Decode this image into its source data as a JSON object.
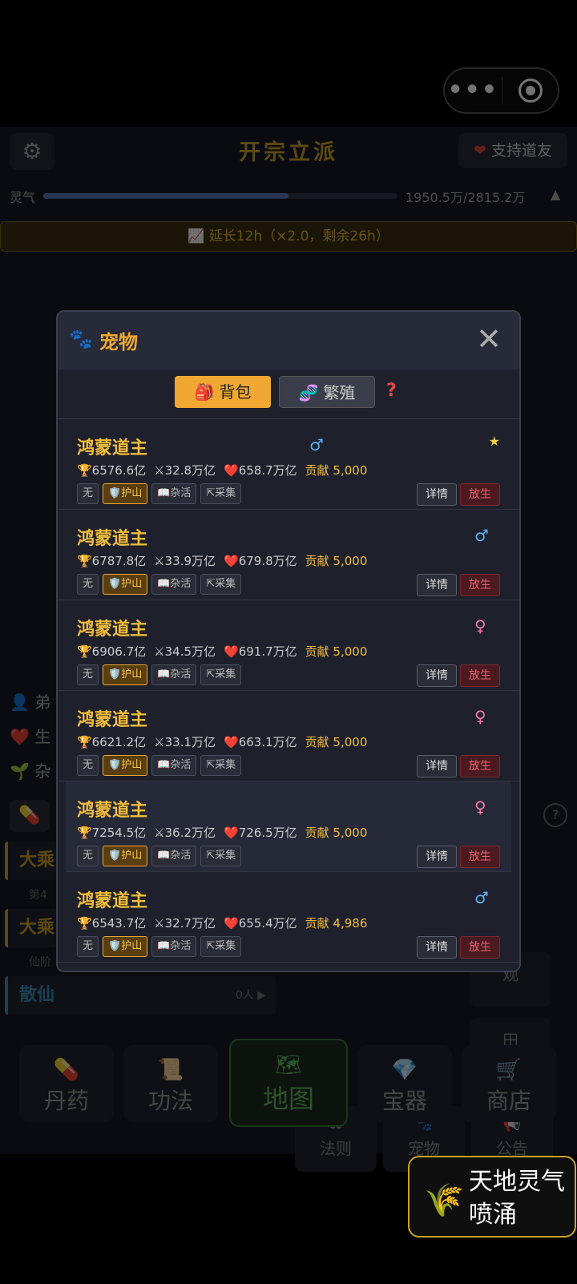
{
  "capsule": {
    "menu_icon": "more-dots-icon",
    "record_icon": "target-icon"
  },
  "header": {
    "title": "开宗立派",
    "support_label": "支持道友"
  },
  "qi": {
    "label": "灵气",
    "value_text": "1950.5万/2815.2万",
    "progress": 0.693
  },
  "boost_text": "📈 延长12h（×2.0，剩余26h）",
  "side_tags": [
    "👤 弟",
    "❤️ 生",
    "🌱 杂"
  ],
  "realms": [
    {
      "name": "大乘"
    },
    {
      "divider": "第4"
    },
    {
      "name": "大乘"
    },
    {
      "divider": "仙阶"
    },
    {
      "name": "散仙",
      "count": "0人 ▶"
    }
  ],
  "tiles": [
    {
      "label": "观",
      "icon": ""
    },
    {
      "label": "田",
      "icon": ""
    },
    {
      "label": "法则",
      "icon": "⚖"
    },
    {
      "label": "宠物",
      "icon": "🐾"
    },
    {
      "label": "公告",
      "icon": "📢"
    }
  ],
  "bottom_nav": [
    {
      "label": "丹药",
      "icon": "💊"
    },
    {
      "label": "功法",
      "icon": "📜"
    },
    {
      "label": "地图",
      "icon": "🗺"
    },
    {
      "label": "宝器",
      "icon": "💎"
    },
    {
      "label": "商店",
      "icon": "🛒"
    }
  ],
  "fab": {
    "text": "天地灵气喷涌",
    "icon": "wheat-icon"
  },
  "modal": {
    "title": "宠物",
    "close": "✕",
    "tabs": {
      "bag": "背包",
      "breed": "繁殖",
      "help": "?"
    },
    "role_labels": {
      "none": "无",
      "guard": "🛡️护山",
      "chores": "📖杂活",
      "gather": "⇱采集"
    },
    "action_labels": {
      "detail": "详情",
      "release": "放生"
    },
    "pets": [
      {
        "name": "鸿蒙道主",
        "gender": "♂",
        "sex": "m",
        "star": "★",
        "power": "🏆6576.6亿",
        "atk": "⚔32.8万亿",
        "hp": "❤️658.7万亿",
        "contrib": "贡献 5,000"
      },
      {
        "name": "鸿蒙道主",
        "gender": "♂",
        "sex": "m",
        "star": "",
        "power": "🏆6787.8亿",
        "atk": "⚔33.9万亿",
        "hp": "❤️679.8万亿",
        "contrib": "贡献 5,000"
      },
      {
        "name": "鸿蒙道主",
        "gender": "♀",
        "sex": "f",
        "star": "",
        "power": "🏆6906.7亿",
        "atk": "⚔34.5万亿",
        "hp": "❤️691.7万亿",
        "contrib": "贡献 5,000"
      },
      {
        "name": "鸿蒙道主",
        "gender": "♀",
        "sex": "f",
        "star": "",
        "power": "🏆6621.2亿",
        "atk": "⚔33.1万亿",
        "hp": "❤️663.1万亿",
        "contrib": "贡献 5,000"
      },
      {
        "name": "鸿蒙道主",
        "gender": "♀",
        "sex": "f",
        "star": "",
        "power": "🏆7254.5亿",
        "atk": "⚔36.2万亿",
        "hp": "❤️726.5万亿",
        "contrib": "贡献 5,000"
      },
      {
        "name": "鸿蒙道主",
        "gender": "♂",
        "sex": "m",
        "star": "",
        "power": "🏆6543.7亿",
        "atk": "⚔32.7万亿",
        "hp": "❤️655.4万亿",
        "contrib": "贡献 4,986"
      }
    ]
  }
}
